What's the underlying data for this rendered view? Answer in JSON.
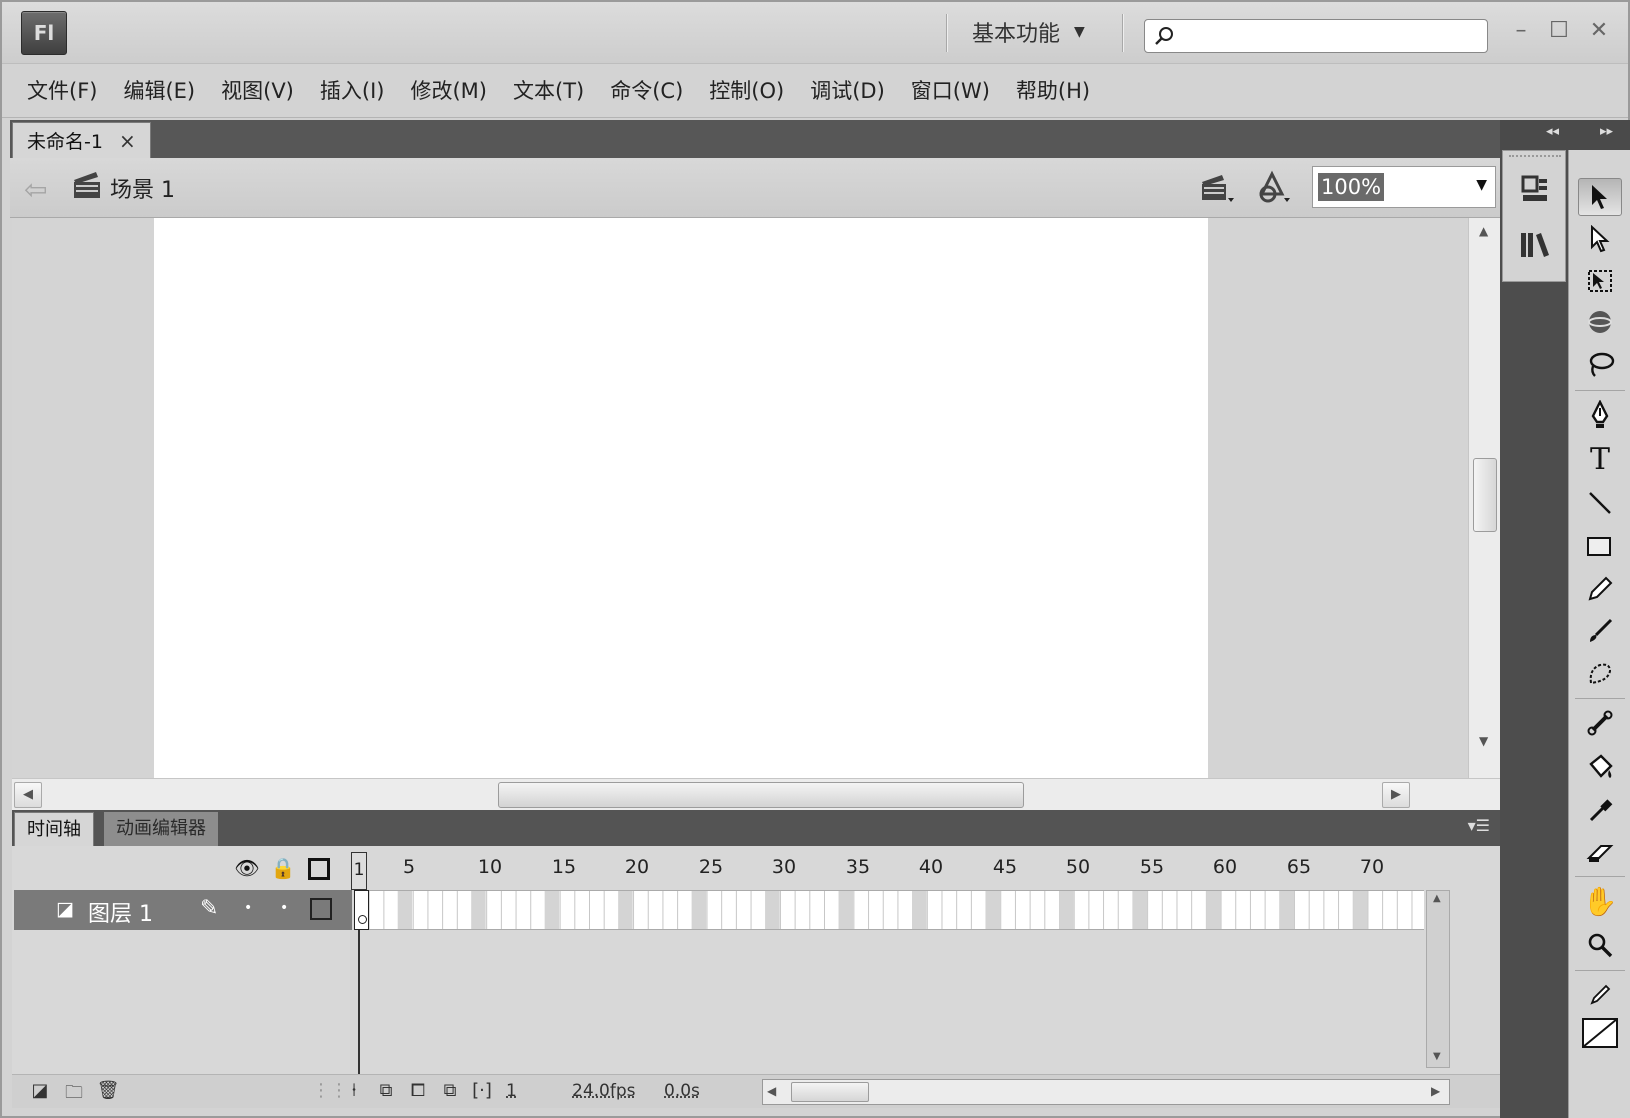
{
  "app": {
    "logo_text": "Fl"
  },
  "titlebar": {
    "workspace_label": "基本功能",
    "workspace_caret": "▼",
    "search_value": "",
    "minimize": "–",
    "maximize": "☐",
    "close": "✕"
  },
  "menu": {
    "items": [
      "文件(F)",
      "编辑(E)",
      "视图(V)",
      "插入(I)",
      "修改(M)",
      "文本(T)",
      "命令(C)",
      "控制(O)",
      "调试(D)",
      "窗口(W)",
      "帮助(H)"
    ]
  },
  "document": {
    "tab_title": "未命名-1",
    "tab_close": "×",
    "scene_label": "场景 1",
    "zoom_value": "100%",
    "stage_color": "#ffffff"
  },
  "timeline": {
    "tabs": [
      "时间轴",
      "动画编辑器"
    ],
    "ruler_numbers": [
      "1",
      "5",
      "10",
      "15",
      "20",
      "25",
      "30",
      "35",
      "40",
      "45",
      "50",
      "55",
      "60",
      "65",
      "70"
    ],
    "layers": [
      {
        "name": "图层 1",
        "selected": true
      }
    ],
    "current_frame": "1",
    "fps": "24.0fps",
    "elapsed": "0.0s"
  },
  "panels": {
    "collapse_left": "◂◂",
    "collapse_right": "▸▸"
  },
  "tools": [
    "selection-tool",
    "subselection-tool",
    "free-transform-tool",
    "3d-rotation-tool",
    "lasso-tool",
    "pen-tool",
    "text-tool",
    "line-tool",
    "rectangle-tool",
    "pencil-tool",
    "brush-tool",
    "deco-tool",
    "bone-tool",
    "paint-bucket-tool",
    "eyedropper-tool",
    "eraser-tool",
    "hand-tool",
    "zoom-tool",
    "stroke-color",
    "fill-color"
  ],
  "colors": {
    "accent_dark": "#545454",
    "layer_selected": "#7a7a7a"
  }
}
